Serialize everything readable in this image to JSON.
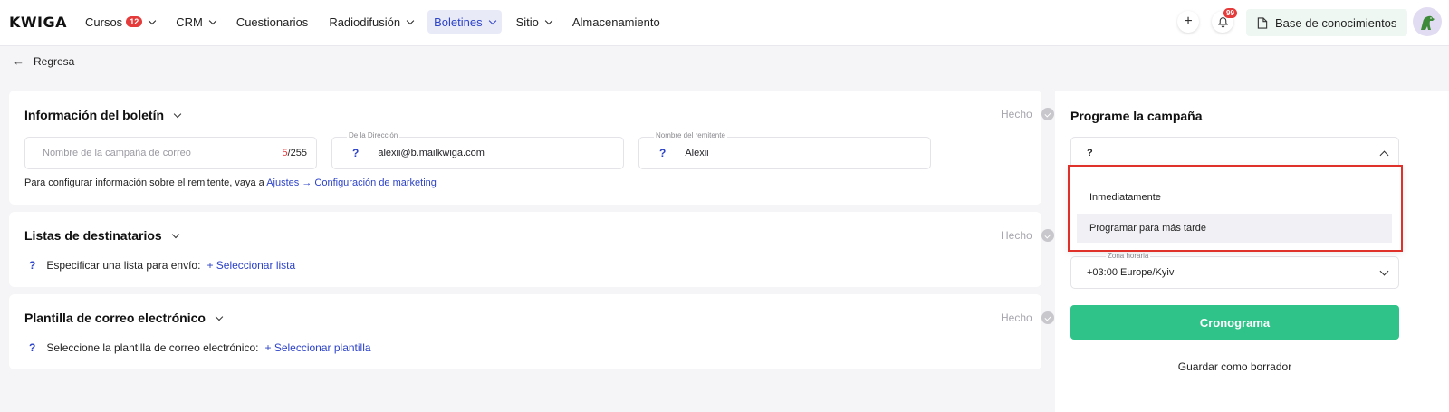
{
  "header": {
    "logo": "KWIGA",
    "nav": [
      {
        "label": "Cursos",
        "badge": "12",
        "has_menu": true
      },
      {
        "label": "CRM",
        "has_menu": true
      },
      {
        "label": "Cuestionarios",
        "has_menu": false
      },
      {
        "label": "Radiodifusión",
        "has_menu": true
      },
      {
        "label": "Boletines",
        "has_menu": true,
        "active": true
      },
      {
        "label": "Sitio",
        "has_menu": true
      },
      {
        "label": "Almacenamiento",
        "has_menu": false
      }
    ],
    "add_icon": "plus-icon",
    "notifications_count": "99",
    "knowledge_base": "Base de conocimientos"
  },
  "back_label": "Regresa",
  "newsletter_info": {
    "title": "Información del boletín",
    "status": "Hecho",
    "campaign_name_placeholder": "Nombre de la campaña de correo",
    "counter_current": "5",
    "counter_max": "/255",
    "from_label": "De la Dirección",
    "from_value": "alexii@b.mailkwiga.com",
    "sender_label": "Nombre del remitente",
    "sender_value": "Alexii",
    "hint_text": "Para configurar información sobre el remitente, vaya a",
    "hint_link": "Ajustes → Configuración de marketing"
  },
  "recipients": {
    "title": "Listas de destinatarios",
    "status": "Hecho",
    "text": "Especificar una lista para envío:",
    "link": "+ Seleccionar lista"
  },
  "template": {
    "title": "Plantilla de correo electrónico",
    "status": "Hecho",
    "text": "Seleccione la plantilla de correo electrónico:",
    "link": "+ Seleccionar plantilla"
  },
  "schedule": {
    "title": "Programe la campaña",
    "select_value": "?",
    "options": [
      "Inmediatamente",
      "Programar para más tarde"
    ],
    "timezone_label": "Zona horaria",
    "timezone_value": "+03:00 Europe/Kyiv",
    "submit": "Cronograma",
    "save_draft": "Guardar como borrador"
  },
  "colors": {
    "accent": "#2d43c8",
    "primary_button": "#2fc38a",
    "highlight_border": "#e0302a",
    "badge": "#e53b3b"
  }
}
